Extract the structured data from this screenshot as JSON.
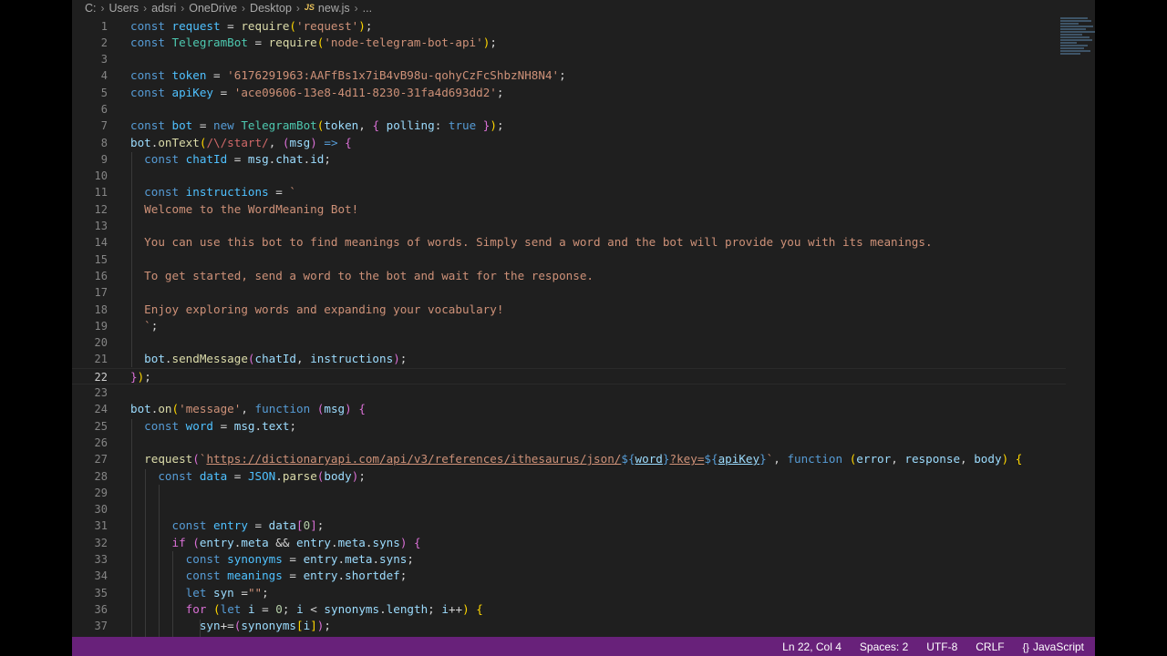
{
  "breadcrumb": {
    "parts": [
      "C:",
      "Users",
      "adsri",
      "OneDrive",
      "Desktop"
    ],
    "file_icon": "JS",
    "file": "new.js",
    "more": "..."
  },
  "editor": {
    "active_line": 22,
    "lines": [
      {
        "n": "1",
        "tokens": [
          [
            "k",
            "const "
          ],
          [
            "c",
            "request"
          ],
          [
            "o",
            " = "
          ],
          [
            "f",
            "require"
          ],
          [
            "b",
            "("
          ],
          [
            "s",
            "'request'"
          ],
          [
            "b",
            ")"
          ],
          [
            "o",
            ";"
          ]
        ]
      },
      {
        "n": "2",
        "tokens": [
          [
            "k",
            "const "
          ],
          [
            "t",
            "TelegramBot"
          ],
          [
            "o",
            " = "
          ],
          [
            "f",
            "require"
          ],
          [
            "b",
            "("
          ],
          [
            "s",
            "'node-telegram-bot-api'"
          ],
          [
            "b",
            ")"
          ],
          [
            "o",
            ";"
          ]
        ]
      },
      {
        "n": "3",
        "tokens": []
      },
      {
        "n": "4",
        "tokens": [
          [
            "k",
            "const "
          ],
          [
            "c",
            "token"
          ],
          [
            "o",
            " = "
          ],
          [
            "s",
            "'6176291963:AAFfBs1x7iB4vB98u-qohyCzFcShbzNH8N4'"
          ],
          [
            "o",
            ";"
          ]
        ]
      },
      {
        "n": "5",
        "tokens": [
          [
            "k",
            "const "
          ],
          [
            "c",
            "apiKey"
          ],
          [
            "o",
            " = "
          ],
          [
            "s",
            "'ace09606-13e8-4d11-8230-31fa4d693dd2'"
          ],
          [
            "o",
            ";"
          ]
        ]
      },
      {
        "n": "6",
        "tokens": []
      },
      {
        "n": "7",
        "tokens": [
          [
            "k",
            "const "
          ],
          [
            "c",
            "bot"
          ],
          [
            "o",
            " = "
          ],
          [
            "k",
            "new "
          ],
          [
            "t",
            "TelegramBot"
          ],
          [
            "b",
            "("
          ],
          [
            "v",
            "token"
          ],
          [
            "o",
            ", "
          ],
          [
            "p",
            "{ "
          ],
          [
            "v",
            "polling"
          ],
          [
            "o",
            ": "
          ],
          [
            "k",
            "true"
          ],
          [
            "p",
            " }"
          ],
          [
            "b",
            ")"
          ],
          [
            "o",
            ";"
          ]
        ]
      },
      {
        "n": "8",
        "tokens": [
          [
            "v",
            "bot"
          ],
          [
            "o",
            "."
          ],
          [
            "f",
            "onText"
          ],
          [
            "b",
            "("
          ],
          [
            "r",
            "/\\/start/"
          ],
          [
            "o",
            ", "
          ],
          [
            "p",
            "("
          ],
          [
            "v",
            "msg"
          ],
          [
            "p",
            ")"
          ],
          [
            "k",
            " => "
          ],
          [
            "p",
            "{"
          ]
        ]
      },
      {
        "n": "9",
        "tokens": [
          [
            "o",
            "  "
          ],
          [
            "k",
            "const "
          ],
          [
            "c",
            "chatId"
          ],
          [
            "o",
            " = "
          ],
          [
            "v",
            "msg"
          ],
          [
            "o",
            "."
          ],
          [
            "v",
            "chat"
          ],
          [
            "o",
            "."
          ],
          [
            "v",
            "id"
          ],
          [
            "o",
            ";"
          ]
        ]
      },
      {
        "n": "10",
        "tokens": []
      },
      {
        "n": "11",
        "tokens": [
          [
            "o",
            "  "
          ],
          [
            "k",
            "const "
          ],
          [
            "c",
            "instructions"
          ],
          [
            "o",
            " = "
          ],
          [
            "s",
            "`"
          ]
        ]
      },
      {
        "n": "12",
        "tokens": [
          [
            "s",
            "  Welcome to the WordMeaning Bot!"
          ]
        ]
      },
      {
        "n": "13",
        "tokens": []
      },
      {
        "n": "14",
        "tokens": [
          [
            "s",
            "  You can use this bot to find meanings of words. Simply send a word and the bot will provide you with its meanings."
          ]
        ]
      },
      {
        "n": "15",
        "tokens": []
      },
      {
        "n": "16",
        "tokens": [
          [
            "s",
            "  To get started, send a word to the bot and wait for the response."
          ]
        ]
      },
      {
        "n": "17",
        "tokens": []
      },
      {
        "n": "18",
        "tokens": [
          [
            "s",
            "  Enjoy exploring words and expanding your vocabulary!"
          ]
        ]
      },
      {
        "n": "19",
        "tokens": [
          [
            "s",
            "  `"
          ],
          [
            "o",
            ";"
          ]
        ]
      },
      {
        "n": "20",
        "tokens": []
      },
      {
        "n": "21",
        "tokens": [
          [
            "o",
            "  "
          ],
          [
            "v",
            "bot"
          ],
          [
            "o",
            "."
          ],
          [
            "f",
            "sendMessage"
          ],
          [
            "p",
            "("
          ],
          [
            "v",
            "chatId"
          ],
          [
            "o",
            ", "
          ],
          [
            "v",
            "instructions"
          ],
          [
            "p",
            ")"
          ],
          [
            "o",
            ";"
          ]
        ]
      },
      {
        "n": "22",
        "tokens": [
          [
            "p",
            "}"
          ],
          [
            "b",
            ")"
          ],
          [
            "o",
            ";"
          ]
        ]
      },
      {
        "n": "23",
        "tokens": []
      },
      {
        "n": "24",
        "tokens": [
          [
            "v",
            "bot"
          ],
          [
            "o",
            "."
          ],
          [
            "f",
            "on"
          ],
          [
            "b",
            "("
          ],
          [
            "s",
            "'message'"
          ],
          [
            "o",
            ", "
          ],
          [
            "k",
            "function "
          ],
          [
            "p",
            "("
          ],
          [
            "v",
            "msg"
          ],
          [
            "p",
            ")"
          ],
          [
            "o",
            " "
          ],
          [
            "p",
            "{"
          ]
        ]
      },
      {
        "n": "25",
        "tokens": [
          [
            "o",
            "  "
          ],
          [
            "k",
            "const "
          ],
          [
            "c",
            "word"
          ],
          [
            "o",
            " = "
          ],
          [
            "v",
            "msg"
          ],
          [
            "o",
            "."
          ],
          [
            "v",
            "text"
          ],
          [
            "o",
            ";"
          ]
        ]
      },
      {
        "n": "26",
        "tokens": []
      },
      {
        "n": "27",
        "tokens": [
          [
            "o",
            "  "
          ],
          [
            "f",
            "request"
          ],
          [
            "p",
            "("
          ],
          [
            "s",
            "`"
          ],
          [
            "su",
            "https://dictionaryapi.com/api/v3/references/ithesaurus/json/"
          ],
          [
            "k",
            "${"
          ],
          [
            "vu",
            "word"
          ],
          [
            "k",
            "}"
          ],
          [
            "su",
            "?key="
          ],
          [
            "k",
            "${"
          ],
          [
            "vu",
            "apiKey"
          ],
          [
            "k",
            "}"
          ],
          [
            "s",
            "`"
          ],
          [
            "o",
            ", "
          ],
          [
            "k",
            "function "
          ],
          [
            "b",
            "("
          ],
          [
            "v",
            "error"
          ],
          [
            "o",
            ", "
          ],
          [
            "v",
            "response"
          ],
          [
            "o",
            ", "
          ],
          [
            "v",
            "body"
          ],
          [
            "b",
            ")"
          ],
          [
            "o",
            " "
          ],
          [
            "b",
            "{"
          ]
        ]
      },
      {
        "n": "28",
        "tokens": [
          [
            "o",
            "    "
          ],
          [
            "k",
            "const "
          ],
          [
            "c",
            "data"
          ],
          [
            "o",
            " = "
          ],
          [
            "c",
            "JSON"
          ],
          [
            "o",
            "."
          ],
          [
            "f",
            "parse"
          ],
          [
            "p",
            "("
          ],
          [
            "v",
            "body"
          ],
          [
            "p",
            ")"
          ],
          [
            "o",
            ";"
          ]
        ]
      },
      {
        "n": "29",
        "tokens": []
      },
      {
        "n": "30",
        "tokens": []
      },
      {
        "n": "31",
        "tokens": [
          [
            "o",
            "      "
          ],
          [
            "k",
            "const "
          ],
          [
            "c",
            "entry"
          ],
          [
            "o",
            " = "
          ],
          [
            "v",
            "data"
          ],
          [
            "p",
            "["
          ],
          [
            "n",
            "0"
          ],
          [
            "p",
            "]"
          ],
          [
            "o",
            ";"
          ]
        ]
      },
      {
        "n": "32",
        "tokens": [
          [
            "o",
            "      "
          ],
          [
            "p",
            "if "
          ],
          [
            "p",
            "("
          ],
          [
            "v",
            "entry"
          ],
          [
            "o",
            "."
          ],
          [
            "v",
            "meta"
          ],
          [
            "o",
            " && "
          ],
          [
            "v",
            "entry"
          ],
          [
            "o",
            "."
          ],
          [
            "v",
            "meta"
          ],
          [
            "o",
            "."
          ],
          [
            "v",
            "syns"
          ],
          [
            "p",
            ")"
          ],
          [
            "o",
            " "
          ],
          [
            "p",
            "{"
          ]
        ]
      },
      {
        "n": "33",
        "tokens": [
          [
            "o",
            "        "
          ],
          [
            "k",
            "const "
          ],
          [
            "c",
            "synonyms"
          ],
          [
            "o",
            " = "
          ],
          [
            "v",
            "entry"
          ],
          [
            "o",
            "."
          ],
          [
            "v",
            "meta"
          ],
          [
            "o",
            "."
          ],
          [
            "v",
            "syns"
          ],
          [
            "o",
            ";"
          ]
        ]
      },
      {
        "n": "34",
        "tokens": [
          [
            "o",
            "        "
          ],
          [
            "k",
            "const "
          ],
          [
            "c",
            "meanings"
          ],
          [
            "o",
            " = "
          ],
          [
            "v",
            "entry"
          ],
          [
            "o",
            "."
          ],
          [
            "v",
            "shortdef"
          ],
          [
            "o",
            ";"
          ]
        ]
      },
      {
        "n": "35",
        "tokens": [
          [
            "o",
            "        "
          ],
          [
            "k",
            "let "
          ],
          [
            "v",
            "syn"
          ],
          [
            "o",
            " ="
          ],
          [
            "s",
            "\"\""
          ],
          [
            "o",
            ";"
          ]
        ]
      },
      {
        "n": "36",
        "tokens": [
          [
            "o",
            "        "
          ],
          [
            "p",
            "for "
          ],
          [
            "b",
            "("
          ],
          [
            "k",
            "let "
          ],
          [
            "v",
            "i"
          ],
          [
            "o",
            " = "
          ],
          [
            "n",
            "0"
          ],
          [
            "o",
            "; "
          ],
          [
            "v",
            "i"
          ],
          [
            "o",
            " < "
          ],
          [
            "v",
            "synonyms"
          ],
          [
            "o",
            "."
          ],
          [
            "v",
            "length"
          ],
          [
            "o",
            "; "
          ],
          [
            "v",
            "i"
          ],
          [
            "o",
            "++"
          ],
          [
            "b",
            ")"
          ],
          [
            "o",
            " "
          ],
          [
            "b",
            "{"
          ]
        ]
      },
      {
        "n": "37",
        "tokens": [
          [
            "o",
            "          "
          ],
          [
            "v",
            "syn"
          ],
          [
            "o",
            "+="
          ],
          [
            "p",
            "("
          ],
          [
            "v",
            "synonyms"
          ],
          [
            "b",
            "["
          ],
          [
            "v",
            "i"
          ],
          [
            "b",
            "]"
          ],
          [
            "p",
            ")"
          ],
          [
            "o",
            ";"
          ]
        ]
      }
    ]
  },
  "statusbar": {
    "position": "Ln 22, Col 4",
    "spaces": "Spaces: 2",
    "encoding": "UTF-8",
    "eol": "CRLF",
    "language_icon": "braces-icon",
    "language": "JavaScript"
  },
  "colors": {
    "statusbar_bg": "#68217a",
    "editor_bg": "#1f1f1f",
    "keyword": "#569cd6",
    "string": "#ce9178",
    "function": "#dcdcaa"
  }
}
